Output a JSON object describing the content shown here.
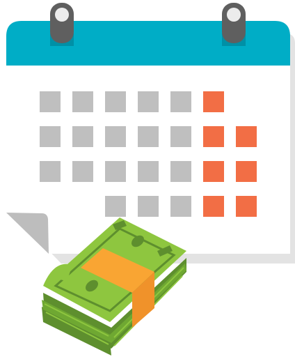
{
  "illustration": {
    "subject": "calendar-with-money-stack",
    "icons": [
      "calendar-icon",
      "money-stack-icon"
    ],
    "calendar": {
      "grid_rows": 4,
      "grid_columns": 7,
      "row_cells": [
        [
          "gray",
          "gray",
          "gray",
          "gray",
          "gray",
          "orange",
          "empty"
        ],
        [
          "gray",
          "gray",
          "gray",
          "gray",
          "gray",
          "orange",
          "orange"
        ],
        [
          "gray",
          "gray",
          "gray",
          "gray",
          "gray",
          "orange",
          "orange"
        ],
        [
          "empty",
          "empty",
          "gray",
          "gray",
          "gray",
          "orange",
          "orange"
        ]
      ],
      "rings": 2,
      "page_curl_corner": "bottom-left"
    },
    "money": {
      "bill_count_visible": 4
    },
    "colors": {
      "header": "#00adc6",
      "header_shadow": "#0090a6",
      "page": "#ffffff",
      "page_shadow": "#e3e3e3",
      "day_cell": "#bfbfbf",
      "weekend_cell": "#f26e45",
      "ring": "#5f5f5f",
      "ring_hole": "#ececec",
      "curl": "#bdbdbd",
      "bill_light": "#8ec63f",
      "bill_dark": "#5e8f2e",
      "bill_mid": "#6fa832",
      "band": "#f9a533",
      "band_dark": "#f0922a"
    }
  }
}
